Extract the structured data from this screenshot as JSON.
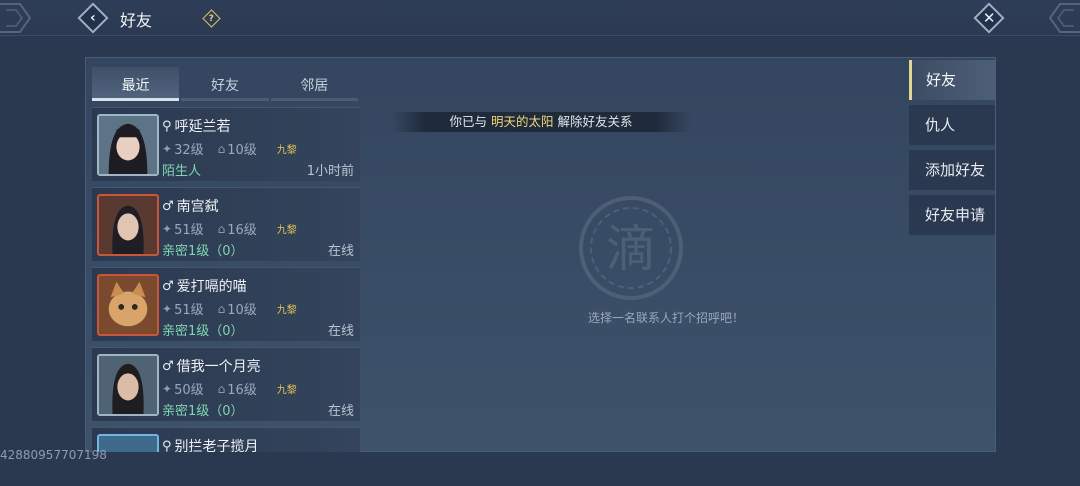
{
  "header": {
    "title": "好友",
    "back_icon": "back-arrow-icon",
    "help_label": "?",
    "close_label": "✕"
  },
  "tabs": [
    {
      "label": "最近",
      "active": true
    },
    {
      "label": "好友",
      "active": false
    },
    {
      "label": "邻居",
      "active": false
    }
  ],
  "contacts": [
    {
      "name": "呼延兰若",
      "gender_icon": "⚲",
      "level": "32级",
      "home_level": "10级",
      "guild": "九黎",
      "relation": "陌生人",
      "status": "1小时前"
    },
    {
      "name": "南宫弑",
      "gender_icon": "♂",
      "level": "51级",
      "home_level": "16级",
      "guild": "九黎",
      "relation": "亲密1级（0）",
      "status": "在线"
    },
    {
      "name": "爱打嗝的喵",
      "gender_icon": "♂",
      "level": "51级",
      "home_level": "10级",
      "guild": "九黎",
      "relation": "亲密1级（0）",
      "status": "在线"
    },
    {
      "name": "借我一个月亮",
      "gender_icon": "♂",
      "level": "50级",
      "home_level": "16级",
      "guild": "九黎",
      "relation": "亲密1级（0）",
      "status": "在线"
    },
    {
      "name": "别拦老子揽月",
      "gender_icon": "⚲",
      "level": "",
      "home_level": "",
      "guild": "",
      "relation": "",
      "status": ""
    }
  ],
  "notice": {
    "prefix": "你已与 ",
    "highlight": "明天的太阳",
    "suffix": " 解除好友关系"
  },
  "emblem_char": "滴",
  "hint": "选择一名联系人打个招呼吧！",
  "side_menu": [
    {
      "label": "好友",
      "active": true
    },
    {
      "label": "仇人",
      "active": false
    },
    {
      "label": "添加好友",
      "active": false
    },
    {
      "label": "好友申请",
      "active": false
    }
  ],
  "watermark": "42880957707198"
}
